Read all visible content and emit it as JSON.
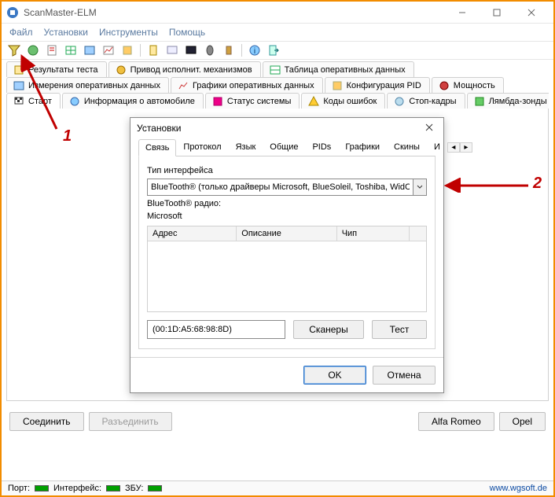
{
  "window": {
    "title": "ScanMaster-ELM"
  },
  "menu": {
    "file": "Файл",
    "settings": "Установки",
    "tools": "Инструменты",
    "help": "Помощь"
  },
  "tabs_row1": {
    "results": "Результаты теста",
    "actuators": "Привод исполнит. механизмов",
    "livedata": "Таблица оперативных данных"
  },
  "tabs_row2": {
    "measurements": "Измерения оперативных данных",
    "graphs": "Графики оперативных данных",
    "pidconfig": "Конфигурация PID",
    "power": "Мощность"
  },
  "tabs_row3": {
    "start": "Старт",
    "vehicleinfo": "Информация о автомобиле",
    "systemstatus": "Статус системы",
    "faultcodes": "Коды ошибок",
    "freezeframes": "Стоп-кадры",
    "lambda": "Лямбда-зонды"
  },
  "buttons": {
    "connect": "Соединить",
    "disconnect": "Разъединить",
    "alfa": "Alfa Romeo",
    "opel": "Opel"
  },
  "statusbar": {
    "port": "Порт:",
    "interface": "Интерфейс:",
    "ecu": "ЗБУ:",
    "url": "www.wgsoft.de"
  },
  "dialog": {
    "title": "Установки",
    "tabs": {
      "conn": "Связь",
      "protocol": "Протокол",
      "language": "Язык",
      "general": "Общие",
      "pids": "PIDs",
      "graphs": "Графики",
      "skins": "Скины",
      "more": "И"
    },
    "iface_label": "Тип интерфейса",
    "iface_value": "BlueTooth® (только драйверы Microsoft, BlueSoleil, Toshiba, WidComm",
    "radio_label": "BlueTooth® радио:",
    "radio_value": "Microsoft",
    "list_cols": {
      "addr": "Адрес",
      "desc": "Описание",
      "chip": "Чип"
    },
    "addr_value": "(00:1D:A5:68:98:8D)",
    "scanners": "Сканеры",
    "test": "Тест",
    "ok": "OK",
    "cancel": "Отмена"
  },
  "annotations": {
    "one": "1",
    "two": "2"
  }
}
